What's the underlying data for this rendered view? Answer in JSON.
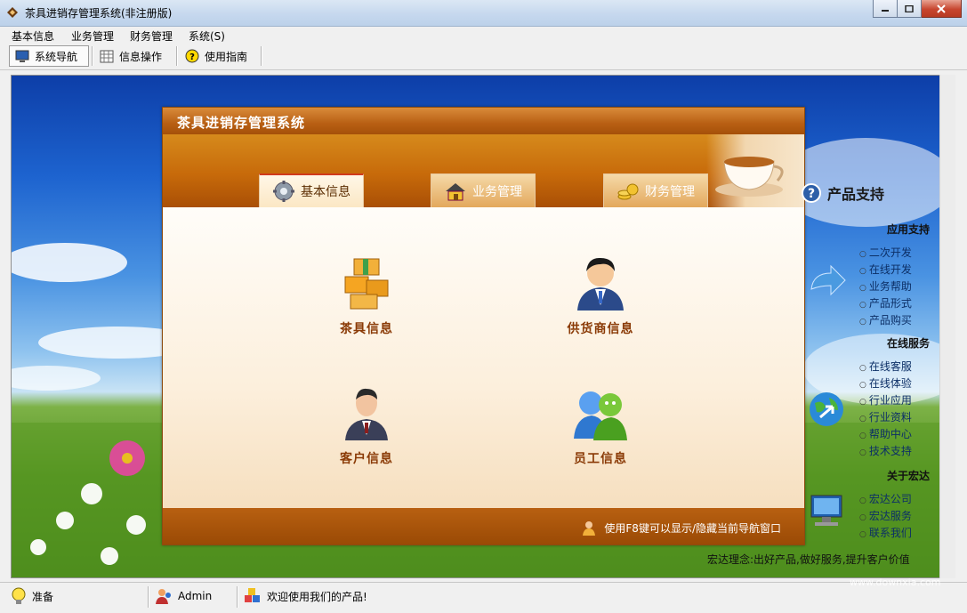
{
  "window": {
    "title": "茶具进销存管理系统(非注册版)"
  },
  "menu": [
    "基本信息",
    "业务管理",
    "财务管理",
    "系统(S)"
  ],
  "toolbar": [
    "系统导航",
    "信息操作",
    "使用指南"
  ],
  "dialog": {
    "title": "茶具进销存管理系统",
    "tabs": [
      "基本信息",
      "业务管理",
      "财务管理"
    ],
    "items": [
      "茶具信息",
      "供货商信息",
      "客户信息",
      "员工信息"
    ],
    "hint": "使用F8键可以显示/隐藏当前导航窗口"
  },
  "side": {
    "title": "产品支持",
    "app_support": {
      "label": "应用支持",
      "links": [
        "二次开发",
        "在线开发",
        "业务帮助",
        "产品形式",
        "产品购买"
      ]
    },
    "online": {
      "label": "在线服务",
      "links": [
        "在线客服",
        "在线体验",
        "行业应用",
        "行业资料",
        "帮助中心",
        "技术支持"
      ]
    },
    "about": {
      "label": "关于宏达",
      "links": [
        "宏达公司",
        "宏达服务",
        "联系我们"
      ]
    },
    "slogan": "宏达理念:出好产品,做好服务,提升客户价值"
  },
  "status": {
    "ready": "准备",
    "user": "Admin",
    "welcome": "欢迎使用我们的产品!"
  },
  "watermark": "www.downxia.com",
  "colors": {
    "title_bar": "#c6d8ee",
    "dialog_header": "#c76a0a",
    "dialog_footer": "#9a4a05",
    "item_label": "#8a3a06"
  }
}
